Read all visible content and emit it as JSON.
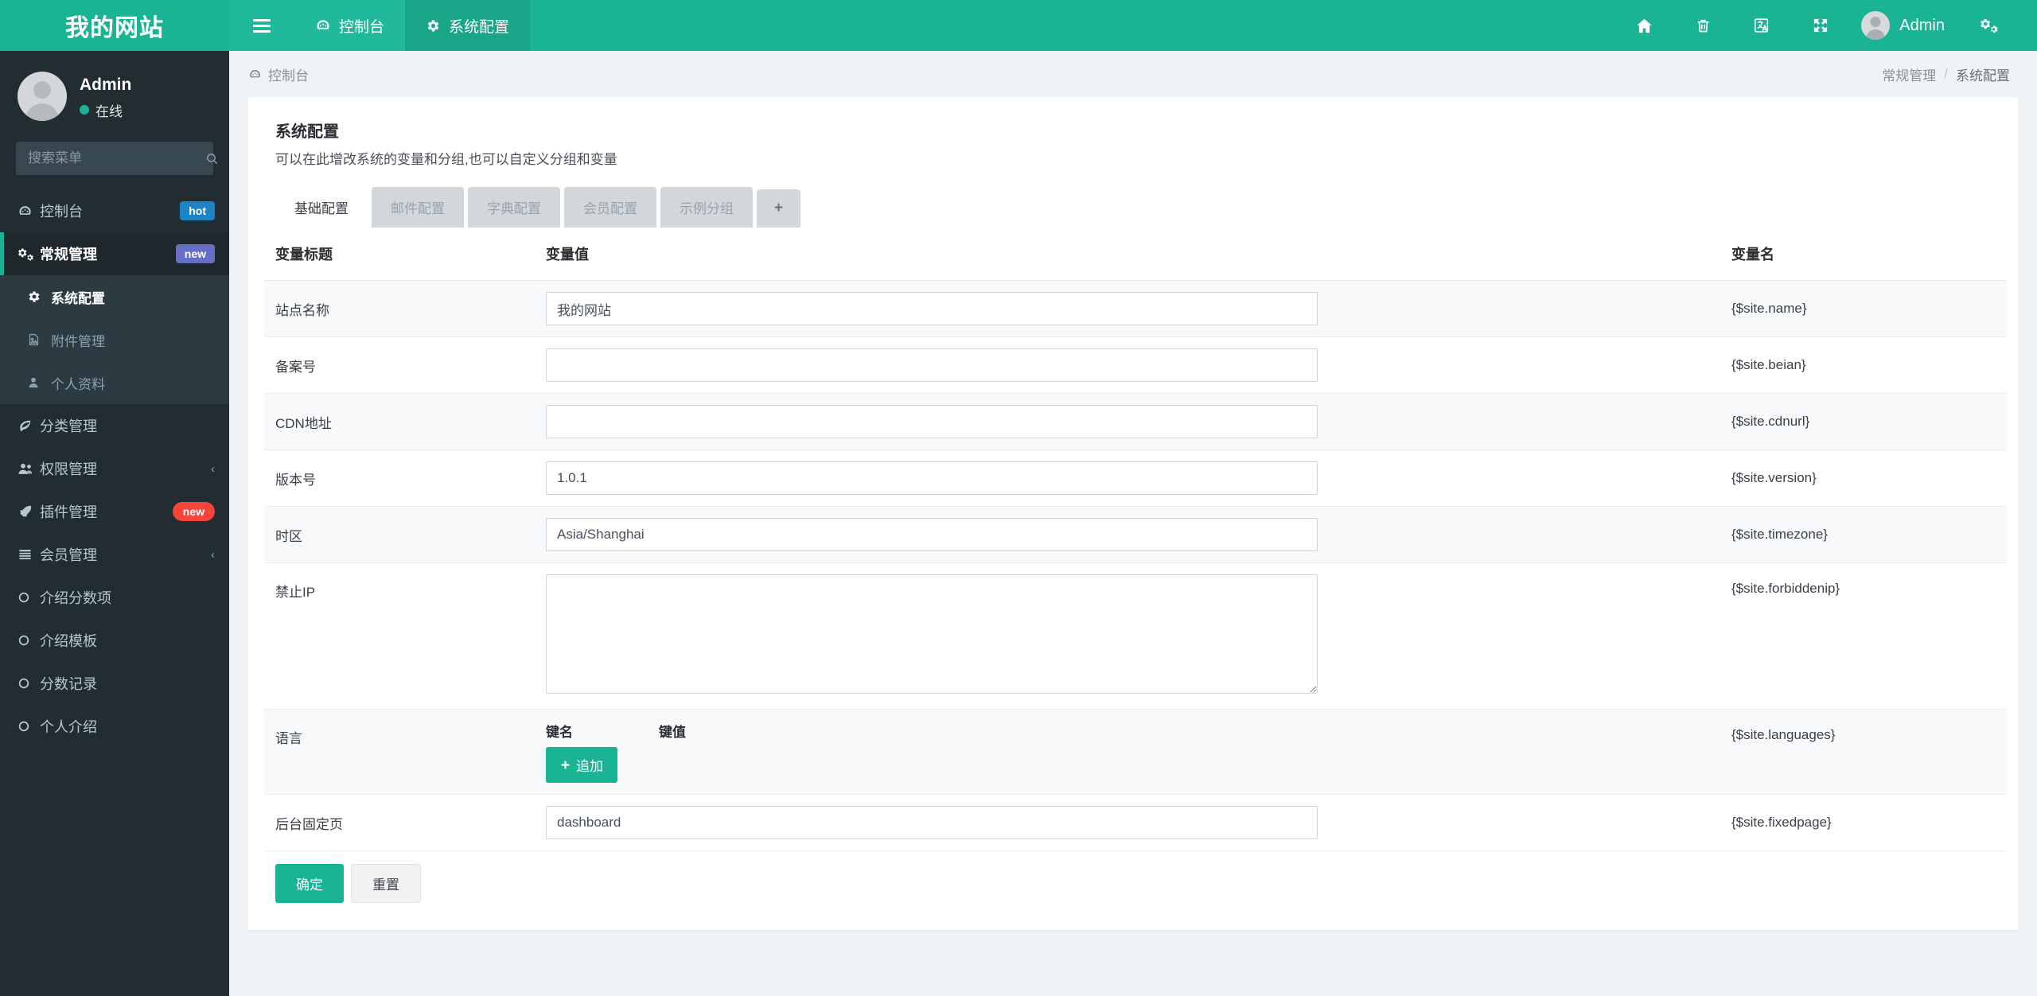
{
  "navbar": {
    "brand": "我的网站",
    "hamburger_label": "",
    "items": [
      {
        "label": "控制台",
        "icon": "dashboard-icon",
        "active": false
      },
      {
        "label": "系统配置",
        "icon": "gear-icon",
        "active": true
      }
    ],
    "right_icons": [
      "home-icon",
      "trash-icon",
      "language-icon",
      "fullscreen-icon"
    ],
    "user": "Admin",
    "settings_icon": "gears-icon"
  },
  "sidebar": {
    "profile": {
      "name": "Admin",
      "status": "在线"
    },
    "search": {
      "value": "",
      "placeholder": "搜索菜单",
      "icon": "search-icon"
    },
    "items": [
      {
        "label": "控制台",
        "icon": "dashboard-icon",
        "badge": "hot",
        "badge_style": "hot"
      },
      {
        "label": "常规管理",
        "icon": "cogs-icon",
        "badge": "new",
        "badge_style": "new-purple",
        "active": true
      },
      {
        "label": "分类管理",
        "icon": "leaf-icon"
      },
      {
        "label": "权限管理",
        "icon": "users-icon",
        "chevron": "‹"
      },
      {
        "label": "插件管理",
        "icon": "rocket-icon",
        "badge": "new",
        "badge_style": "new-red"
      },
      {
        "label": "会员管理",
        "icon": "list-icon",
        "chevron": "‹"
      },
      {
        "label": "介绍分数项",
        "icon": "circle-icon"
      },
      {
        "label": "介绍模板",
        "icon": "circle-icon"
      },
      {
        "label": "分数记录",
        "icon": "circle-icon"
      },
      {
        "label": "个人介绍",
        "icon": "circle-icon"
      }
    ],
    "submenu": [
      {
        "label": "系统配置",
        "icon": "gear-icon",
        "active": true
      },
      {
        "label": "附件管理",
        "icon": "image-file-icon",
        "active": false
      },
      {
        "label": "个人资料",
        "icon": "user-icon",
        "active": false
      }
    ]
  },
  "breadcrumb": {
    "left_icon": "dashboard-icon",
    "left_label": "控制台",
    "right": [
      "常规管理",
      "系统配置"
    ],
    "separator": "/"
  },
  "panel": {
    "title": "系统配置",
    "description": "可以在此增改系统的变量和分组,也可以自定义分组和变量"
  },
  "tabs": [
    {
      "label": "基础配置",
      "active": true
    },
    {
      "label": "邮件配置",
      "active": false
    },
    {
      "label": "字典配置",
      "active": false
    },
    {
      "label": "会员配置",
      "active": false
    },
    {
      "label": "示例分组",
      "active": false
    },
    {
      "label": "+",
      "active": false,
      "is_plus": true
    }
  ],
  "table": {
    "headers": {
      "title": "变量标题",
      "value": "变量值",
      "name": "变量名"
    },
    "rows": [
      {
        "title": "站点名称",
        "type": "text",
        "value": "我的网站",
        "placeholder": "",
        "name": "{$site.name}"
      },
      {
        "title": "备案号",
        "type": "text",
        "value": "",
        "placeholder": "",
        "name": "{$site.beian}"
      },
      {
        "title": "CDN地址",
        "type": "text",
        "value": "",
        "placeholder": "",
        "name": "{$site.cdnurl}"
      },
      {
        "title": "版本号",
        "type": "text",
        "value": "1.0.1",
        "placeholder": "",
        "name": "{$site.version}"
      },
      {
        "title": "时区",
        "type": "text",
        "value": "Asia/Shanghai",
        "placeholder": "",
        "name": "{$site.timezone}"
      },
      {
        "title": "禁止IP",
        "type": "textarea",
        "value": "",
        "placeholder": "",
        "name": "{$site.forbiddenip}"
      },
      {
        "title": "语言",
        "type": "keyvalue",
        "value": "",
        "placeholder": "",
        "name": "{$site.languages}",
        "kv": {
          "key_header": "键名",
          "value_header": "键值",
          "add_label": "追加",
          "add_icon": "plus-icon"
        }
      },
      {
        "title": "后台固定页",
        "type": "text",
        "value": "dashboard",
        "placeholder": "",
        "name": "{$site.fixedpage}"
      }
    ]
  },
  "form_actions": {
    "submit": "确定",
    "reset": "重置"
  },
  "colors": {
    "brand_green": "#1ab394",
    "nav_green": "#21b99c",
    "nav_active_green": "#18a588",
    "sidebar_dark": "#222d32",
    "sidebar_submenu": "#2c3b41",
    "body_bg": "#f0f3f5",
    "badge_hot": "#1c84c6",
    "badge_new_purple": "#676fc4",
    "badge_new_red": "#f4443c"
  }
}
